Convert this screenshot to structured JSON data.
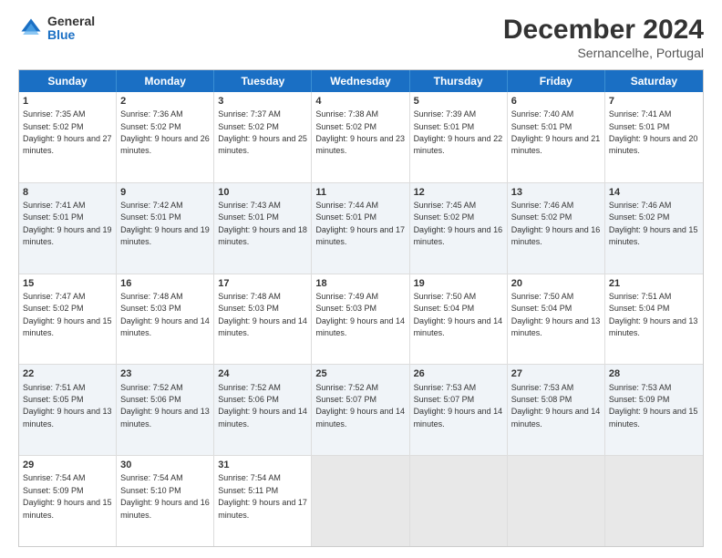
{
  "logo": {
    "general": "General",
    "blue": "Blue"
  },
  "title": "December 2024",
  "location": "Sernancelhe, Portugal",
  "days": [
    "Sunday",
    "Monday",
    "Tuesday",
    "Wednesday",
    "Thursday",
    "Friday",
    "Saturday"
  ],
  "weeks": [
    [
      {
        "day": "1",
        "sunrise": "7:35 AM",
        "sunset": "5:02 PM",
        "daylight": "9 hours and 27 minutes."
      },
      {
        "day": "2",
        "sunrise": "7:36 AM",
        "sunset": "5:02 PM",
        "daylight": "9 hours and 26 minutes."
      },
      {
        "day": "3",
        "sunrise": "7:37 AM",
        "sunset": "5:02 PM",
        "daylight": "9 hours and 25 minutes."
      },
      {
        "day": "4",
        "sunrise": "7:38 AM",
        "sunset": "5:02 PM",
        "daylight": "9 hours and 23 minutes."
      },
      {
        "day": "5",
        "sunrise": "7:39 AM",
        "sunset": "5:01 PM",
        "daylight": "9 hours and 22 minutes."
      },
      {
        "day": "6",
        "sunrise": "7:40 AM",
        "sunset": "5:01 PM",
        "daylight": "9 hours and 21 minutes."
      },
      {
        "day": "7",
        "sunrise": "7:41 AM",
        "sunset": "5:01 PM",
        "daylight": "9 hours and 20 minutes."
      }
    ],
    [
      {
        "day": "8",
        "sunrise": "7:41 AM",
        "sunset": "5:01 PM",
        "daylight": "9 hours and 19 minutes."
      },
      {
        "day": "9",
        "sunrise": "7:42 AM",
        "sunset": "5:01 PM",
        "daylight": "9 hours and 19 minutes."
      },
      {
        "day": "10",
        "sunrise": "7:43 AM",
        "sunset": "5:01 PM",
        "daylight": "9 hours and 18 minutes."
      },
      {
        "day": "11",
        "sunrise": "7:44 AM",
        "sunset": "5:01 PM",
        "daylight": "9 hours and 17 minutes."
      },
      {
        "day": "12",
        "sunrise": "7:45 AM",
        "sunset": "5:02 PM",
        "daylight": "9 hours and 16 minutes."
      },
      {
        "day": "13",
        "sunrise": "7:46 AM",
        "sunset": "5:02 PM",
        "daylight": "9 hours and 16 minutes."
      },
      {
        "day": "14",
        "sunrise": "7:46 AM",
        "sunset": "5:02 PM",
        "daylight": "9 hours and 15 minutes."
      }
    ],
    [
      {
        "day": "15",
        "sunrise": "7:47 AM",
        "sunset": "5:02 PM",
        "daylight": "9 hours and 15 minutes."
      },
      {
        "day": "16",
        "sunrise": "7:48 AM",
        "sunset": "5:03 PM",
        "daylight": "9 hours and 14 minutes."
      },
      {
        "day": "17",
        "sunrise": "7:48 AM",
        "sunset": "5:03 PM",
        "daylight": "9 hours and 14 minutes."
      },
      {
        "day": "18",
        "sunrise": "7:49 AM",
        "sunset": "5:03 PM",
        "daylight": "9 hours and 14 minutes."
      },
      {
        "day": "19",
        "sunrise": "7:50 AM",
        "sunset": "5:04 PM",
        "daylight": "9 hours and 14 minutes."
      },
      {
        "day": "20",
        "sunrise": "7:50 AM",
        "sunset": "5:04 PM",
        "daylight": "9 hours and 13 minutes."
      },
      {
        "day": "21",
        "sunrise": "7:51 AM",
        "sunset": "5:04 PM",
        "daylight": "9 hours and 13 minutes."
      }
    ],
    [
      {
        "day": "22",
        "sunrise": "7:51 AM",
        "sunset": "5:05 PM",
        "daylight": "9 hours and 13 minutes."
      },
      {
        "day": "23",
        "sunrise": "7:52 AM",
        "sunset": "5:06 PM",
        "daylight": "9 hours and 13 minutes."
      },
      {
        "day": "24",
        "sunrise": "7:52 AM",
        "sunset": "5:06 PM",
        "daylight": "9 hours and 14 minutes."
      },
      {
        "day": "25",
        "sunrise": "7:52 AM",
        "sunset": "5:07 PM",
        "daylight": "9 hours and 14 minutes."
      },
      {
        "day": "26",
        "sunrise": "7:53 AM",
        "sunset": "5:07 PM",
        "daylight": "9 hours and 14 minutes."
      },
      {
        "day": "27",
        "sunrise": "7:53 AM",
        "sunset": "5:08 PM",
        "daylight": "9 hours and 14 minutes."
      },
      {
        "day": "28",
        "sunrise": "7:53 AM",
        "sunset": "5:09 PM",
        "daylight": "9 hours and 15 minutes."
      }
    ],
    [
      {
        "day": "29",
        "sunrise": "7:54 AM",
        "sunset": "5:09 PM",
        "daylight": "9 hours and 15 minutes."
      },
      {
        "day": "30",
        "sunrise": "7:54 AM",
        "sunset": "5:10 PM",
        "daylight": "9 hours and 16 minutes."
      },
      {
        "day": "31",
        "sunrise": "7:54 AM",
        "sunset": "5:11 PM",
        "daylight": "9 hours and 17 minutes."
      },
      null,
      null,
      null,
      null
    ]
  ]
}
